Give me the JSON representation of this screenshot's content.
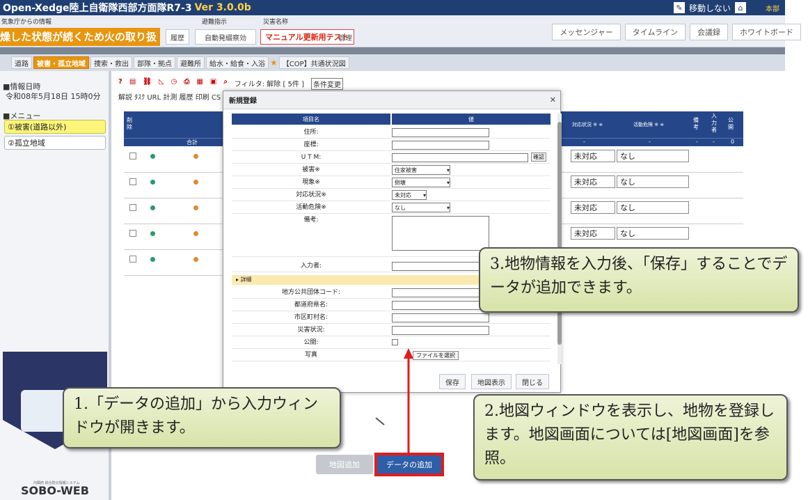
{
  "app": {
    "title": "Open-Xedge陸上自衛隊西部方面隊R7-3",
    "version": "Ver 3.0.0b",
    "move_label": "移動しない",
    "org": "本部"
  },
  "infobar": {
    "weather_label": "気象庁からの情報",
    "evac_label": "避難指示",
    "disaster_label": "災害名称",
    "alert_text": "燥した状態が続くため火の取り扱",
    "history": "履歴",
    "auto_evac": "自動発綴察効",
    "manual_test": "マニュアル更新用テスト",
    "manage": "管理",
    "right_buttons": [
      "メッセンジャー",
      "タイムライン",
      "会議録",
      "ホワイトボード"
    ]
  },
  "tabs": [
    "道路",
    "被害・孤立地域",
    "捜索・救出",
    "部隊・拠点",
    "避難所",
    "給水・給食・入浴",
    "【COP】共通状況図"
  ],
  "sidebar": {
    "info_date_label": "■情報日時",
    "info_date_value": "令和08年5月18日 15時0分",
    "menu_label": "■メニュー",
    "items": [
      "①被害(道路以外)",
      "②孤立地域"
    ]
  },
  "toolbar": {
    "labels": "解説 ﾀｽｸ URL 計測 履歴 印刷 CS",
    "filter": "フィルタ: 解除 [ 5件 ]",
    "condition_change": "条件変更"
  },
  "table": {
    "col_delete": "削除",
    "col_total": "合計",
    "col_status": "対応状況 ※ ≑",
    "col_danger": "活動危険 ※ ≑",
    "col_note": "備考",
    "col_inputter": "入力者",
    "col_public": "公開",
    "dash": "-",
    "zero": "0",
    "rows": [
      {
        "status": "未対応",
        "danger": "なし"
      },
      {
        "status": "未対応",
        "danger": "なし"
      },
      {
        "status": "未対応",
        "danger": "なし"
      },
      {
        "status": "未対応",
        "danger": "なし"
      }
    ]
  },
  "modal": {
    "title": "新規登録",
    "col_item": "項目名",
    "col_value": "値",
    "fields": {
      "address": "住所:",
      "coords": "座標:",
      "utm": "U T M:",
      "confirm": "確認",
      "damage": "被害※",
      "damage_value": "住家被害",
      "phenomenon": "現象※",
      "phenomenon_value": "倒壊",
      "status": "対応状況※",
      "status_value": "未対応",
      "danger": "活動危険※",
      "danger_value": "なし",
      "note": "備考:",
      "inputter": "入力者:",
      "detail": "詳細",
      "local_code": "地方公共団体コード:",
      "prefecture": "都道府県名:",
      "city": "市区町村名:",
      "disaster_status": "災害状況:",
      "public": "公開:",
      "photo": "写真",
      "file_select": "ファイルを選択"
    },
    "save": "保存",
    "map_display": "地図表示",
    "close": "閉じる"
  },
  "bottom": {
    "map_add": "地図追加",
    "data_add": "データの追加"
  },
  "logo": {
    "name": "SOBO-WEB",
    "sub": "内閣府 総合防災情報システム"
  },
  "callouts": {
    "c1": "1.「データの追加」から入力ウィンドウが開きます。",
    "c2": "2.地図ウィンドウを表示し、地物を登録します。地図画面については[地図画面]を参照。",
    "c3": "3.地物情報を入力後、「保存」することでデータが追加できます。"
  },
  "colors": {
    "titlebar": "#1f3f73",
    "accent_orange": "#e8950f",
    "highlight_red": "#e01c1c",
    "table_header": "#25478a",
    "callout_fill": "#dbe6b0"
  }
}
